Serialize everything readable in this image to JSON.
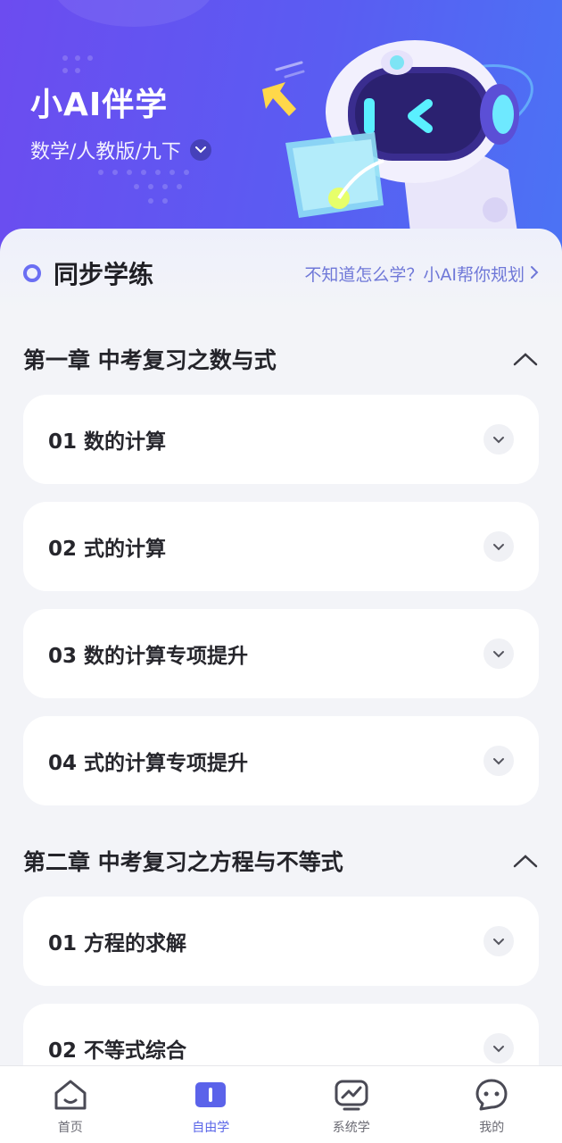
{
  "header": {
    "title": "小AI伴学",
    "subject": "数学/人教版/九下"
  },
  "section": {
    "title": "同步学练",
    "plan_link": "不知道怎么学？小AI帮你规划"
  },
  "chapters": [
    {
      "title": "第一章 中考复习之数与式",
      "lessons": [
        "01 数的计算",
        "02 式的计算",
        "03 数的计算专项提升",
        "04 式的计算专项提升"
      ]
    },
    {
      "title": "第二章 中考复习之方程与不等式",
      "lessons": [
        "01 方程的求解",
        "02 不等式综合"
      ]
    }
  ],
  "nav": [
    {
      "label": "首页",
      "icon": "home-icon"
    },
    {
      "label": "自由学",
      "icon": "book-icon",
      "active": true
    },
    {
      "label": "系统学",
      "icon": "chart-icon"
    },
    {
      "label": "我的",
      "icon": "profile-face-icon"
    }
  ],
  "colors": {
    "header_gradient_start": "#6c4cf0",
    "header_gradient_end": "#4b73f4",
    "accent": "#5965e8",
    "link": "#6f78d8"
  }
}
